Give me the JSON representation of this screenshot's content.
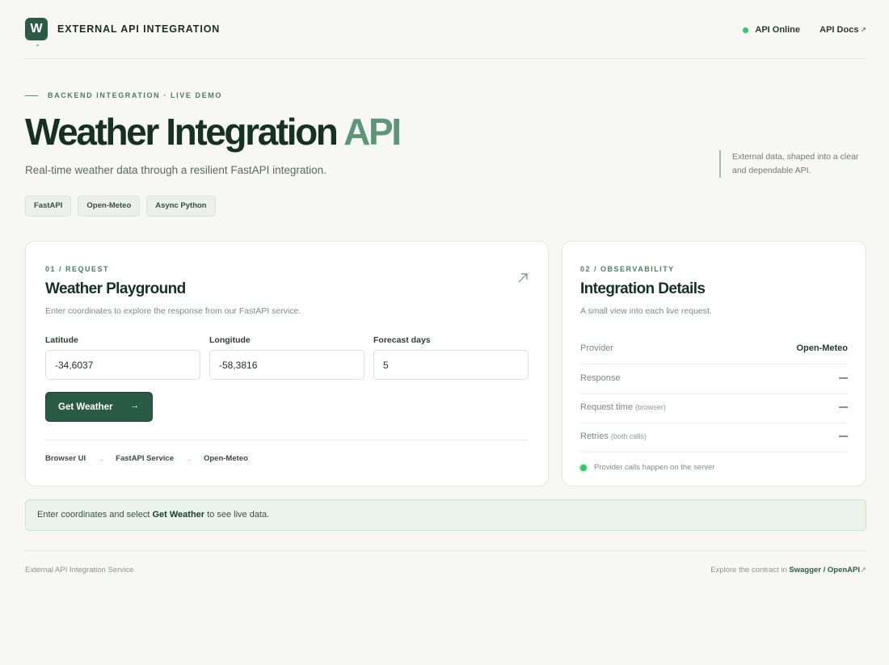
{
  "header": {
    "logo_letter": "W",
    "brand": "EXTERNAL API INTEGRATION",
    "status": "API Online",
    "docs_link": "API Docs",
    "docs_arrow": "↗"
  },
  "hero": {
    "eyebrow": "BACKEND INTEGRATION · LIVE DEMO",
    "title_main": "Weather Integration ",
    "title_accent": "API",
    "subtitle": "Real-time weather data through a resilient FastAPI integration.",
    "tags": [
      "FastAPI",
      "Open-Meteo",
      "Async Python"
    ],
    "side_note": "External data, shaped into a clear and dependable API."
  },
  "request": {
    "eyebrow": "01 / REQUEST",
    "title": "Weather Playground",
    "description": "Enter coordinates to explore the response from our FastAPI service.",
    "fields": {
      "latitude_label": "Latitude",
      "latitude_value": "-34,6037",
      "longitude_label": "Longitude",
      "longitude_value": "-58,3816",
      "days_label": "Forecast days",
      "days_value": "5"
    },
    "button_label": "Get Weather",
    "button_arrow": "→",
    "flow": [
      "Browser UI",
      "FastAPI Service",
      "Open-Meteo"
    ],
    "flow_sep": "→"
  },
  "details": {
    "eyebrow": "02 / OBSERVABILITY",
    "title": "Integration Details",
    "description": "A small view into each live request.",
    "rows": [
      {
        "key": "Provider",
        "note": "",
        "value": "Open-Meteo"
      },
      {
        "key": "Response",
        "note": "",
        "value": "—"
      },
      {
        "key": "Request time",
        "note": "(browser)",
        "value": "—"
      },
      {
        "key": "Retries",
        "note": "(both calls)",
        "value": "—"
      }
    ],
    "footnote": "Provider calls happen on the server"
  },
  "banner": {
    "prefix": "Enter coordinates and select ",
    "bold": "Get Weather",
    "suffix": " to see live data."
  },
  "footer": {
    "left": "External API Integration Service",
    "right_prefix": "Explore the contract in ",
    "right_link": "Swagger / OpenAPI",
    "right_arrow": "↗"
  },
  "colors": {
    "brand_green": "#2d5a45",
    "accent_green": "#5e9478",
    "status_green": "#34c46a",
    "background": "#f7f7f6"
  }
}
